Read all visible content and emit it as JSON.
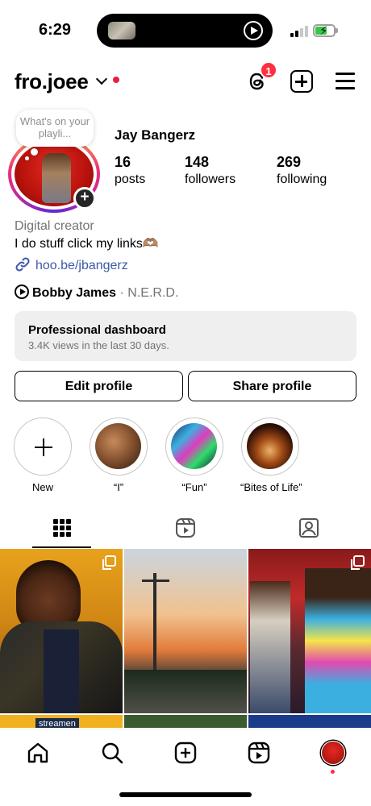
{
  "status_bar": {
    "time": "6:29"
  },
  "header": {
    "username": "fro.joee",
    "threads_badge": "1"
  },
  "profile": {
    "note": "What's on your playli...",
    "full_name": "Jay Bangerz",
    "stats": {
      "posts_count": "16",
      "posts_label": "posts",
      "followers_count": "148",
      "followers_label": "followers",
      "following_count": "269",
      "following_label": "following"
    },
    "category": "Digital creator",
    "bio": "I do stuff click my links🫶🏽",
    "link": "hoo.be/jbangerz",
    "music": {
      "artist": "Bobby James",
      "separator": " · ",
      "song": "N.E.R.D."
    }
  },
  "dashboard": {
    "title": "Professional dashboard",
    "subtitle": "3.4K views in the last 30 days."
  },
  "buttons": {
    "edit": "Edit profile",
    "share": "Share profile"
  },
  "highlights": [
    {
      "label": "New"
    },
    {
      "label": "“I”"
    },
    {
      "label": "“Fun”"
    },
    {
      "label": "“Bites of Life”"
    }
  ],
  "grid": {
    "post1_caption": "streamen"
  },
  "colors": {
    "accent_red": "#ff3040",
    "link_blue": "#3d58a8",
    "muted": "#737373"
  },
  "icons": [
    "threads-icon",
    "add-icon",
    "menu-icon",
    "grid-icon",
    "reels-icon",
    "tagged-icon",
    "home-icon",
    "search-icon",
    "create-icon",
    "reels-nav-icon"
  ]
}
